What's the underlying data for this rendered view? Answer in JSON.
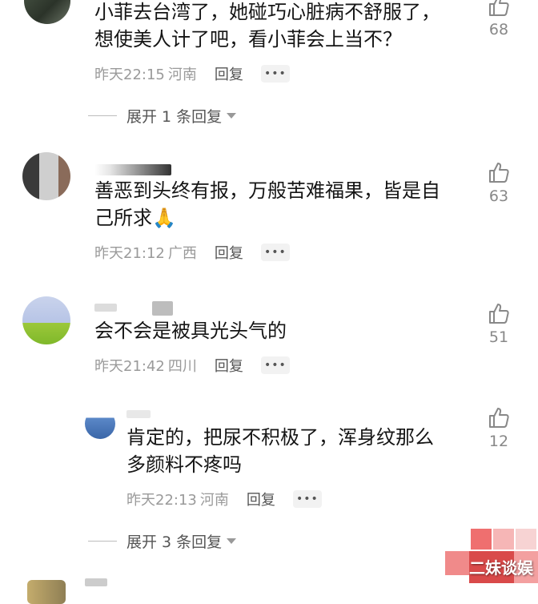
{
  "comments": [
    {
      "text_lines": [
        "小菲去台湾了，她碰巧心脏病不舒服了，",
        "想使美人计了吧，看小菲会上当不？"
      ],
      "time": "昨天22:15",
      "location": "河南",
      "reply_label": "回复",
      "more_label": "•••",
      "likes": "68"
    },
    {
      "text_lines": [
        "善恶到头终有报，万般苦难福果，皆是自",
        "己所求🙏"
      ],
      "time": "昨天21:12",
      "location": "广西",
      "reply_label": "回复",
      "more_label": "•••",
      "likes": "63"
    },
    {
      "text_lines": [
        "会不会是被具光头气的"
      ],
      "time": "昨天21:42",
      "location": "四川",
      "reply_label": "回复",
      "more_label": "•••",
      "likes": "51"
    },
    {
      "text_lines": [
        "肯定的，把尿不积极了，浑身纹那么",
        "多颜料不疼吗"
      ],
      "time": "昨天22:13",
      "location": "河南",
      "reply_label": "回复",
      "more_label": "•••",
      "likes": "12"
    }
  ],
  "expand_replies": [
    {
      "label": "展开 1 条回复"
    },
    {
      "label": "展开 3 条回复"
    }
  ],
  "watermark": {
    "text": "二妹谈娱"
  },
  "icons": {
    "like": "thumbs-up-icon",
    "expand": "caret-down-icon",
    "more": "more-dots-icon"
  },
  "colors": {
    "text": "#151515",
    "meta": "#9a9a9a",
    "reply": "#555555",
    "like_count": "#888888"
  }
}
